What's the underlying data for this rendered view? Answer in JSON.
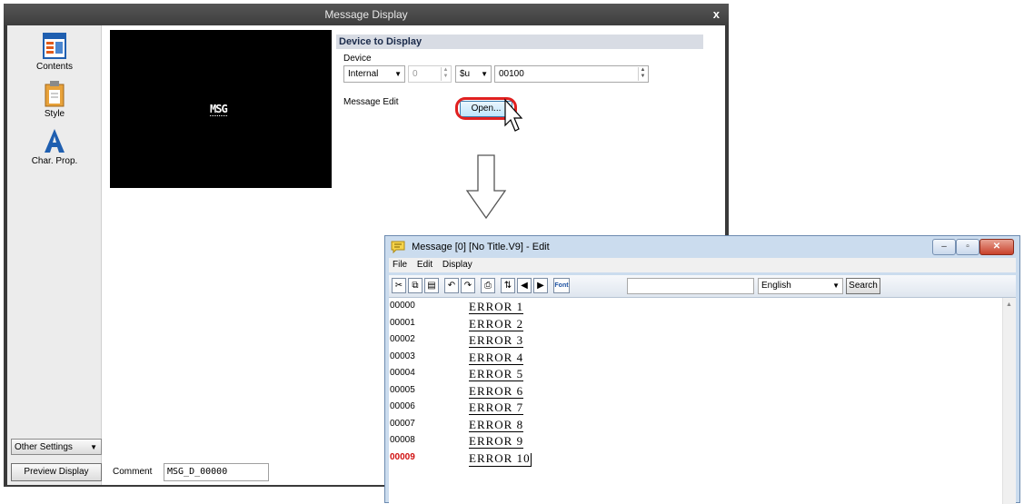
{
  "dialog": {
    "title": "Message Display",
    "close_glyph": "x",
    "sidebar": {
      "items": [
        {
          "label": "Contents",
          "icon": "contents-icon"
        },
        {
          "label": "Style",
          "icon": "style-icon"
        },
        {
          "label": "Char. Prop.",
          "icon": "char-prop-icon"
        }
      ],
      "other_settings": "Other Settings",
      "preview_button": "Preview Display"
    },
    "comment": {
      "label": "Comment",
      "value": "MSG_D_00000"
    },
    "preview_text": "MSG",
    "device_section": {
      "header": "Device to Display",
      "device_label": "Device",
      "type_select": "Internal",
      "number": "0",
      "prefix_select": "$u",
      "address": "00100",
      "message_edit_label": "Message Edit",
      "open_button": "Open..."
    }
  },
  "edit_window": {
    "title": "Message [0] [No Title.V9] - Edit",
    "menu": [
      "File",
      "Edit",
      "Display"
    ],
    "font_button": "Font",
    "language": "English",
    "search_button": "Search",
    "rows": [
      {
        "num": "00000",
        "text": "ERROR 1"
      },
      {
        "num": "00001",
        "text": "ERROR 2"
      },
      {
        "num": "00002",
        "text": "ERROR 3"
      },
      {
        "num": "00003",
        "text": "ERROR 4"
      },
      {
        "num": "00004",
        "text": "ERROR 5"
      },
      {
        "num": "00005",
        "text": "ERROR 6"
      },
      {
        "num": "00006",
        "text": "ERROR 7"
      },
      {
        "num": "00007",
        "text": "ERROR 8"
      },
      {
        "num": "00008",
        "text": "ERROR 9"
      },
      {
        "num": "00009",
        "text": "ERROR 10"
      }
    ],
    "active_row": "00009"
  },
  "colors": {
    "highlight_ring": "#e02020",
    "active_row_number": "#d01010"
  }
}
